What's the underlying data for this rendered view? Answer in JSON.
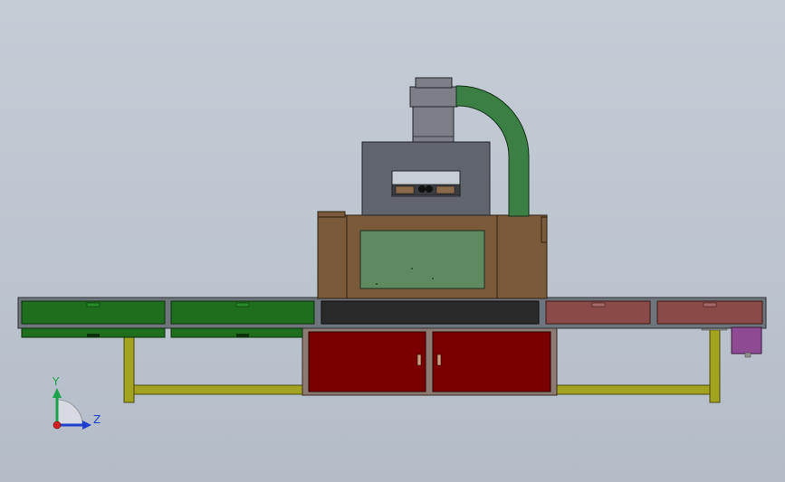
{
  "viewport": {
    "background": "#bfc7d1"
  },
  "triad": {
    "y_label": "Y",
    "z_label": "Z",
    "y_color": "#1aa34a",
    "z_color": "#1f3fd1",
    "x_color": "#d11f1f"
  },
  "colors": {
    "frame_yellow": "#a3a31f",
    "frame_outline": "#4a4a10",
    "conveyor_grey": "#6f757d",
    "green_panel": "#1e6e1e",
    "dark_panel": "#2a2a2a",
    "rose_panel": "#8a4a48",
    "cabinet_red": "#7a0000",
    "cabinet_frame": "#8d7a72",
    "housing_brown": "#7a5a3a",
    "window_green": "#5f8a5f",
    "hood_grey": "#60646d",
    "duct_green": "#3c7f44",
    "stack_grey": "#7c7f86",
    "motor_purple": "#8e4a92"
  }
}
